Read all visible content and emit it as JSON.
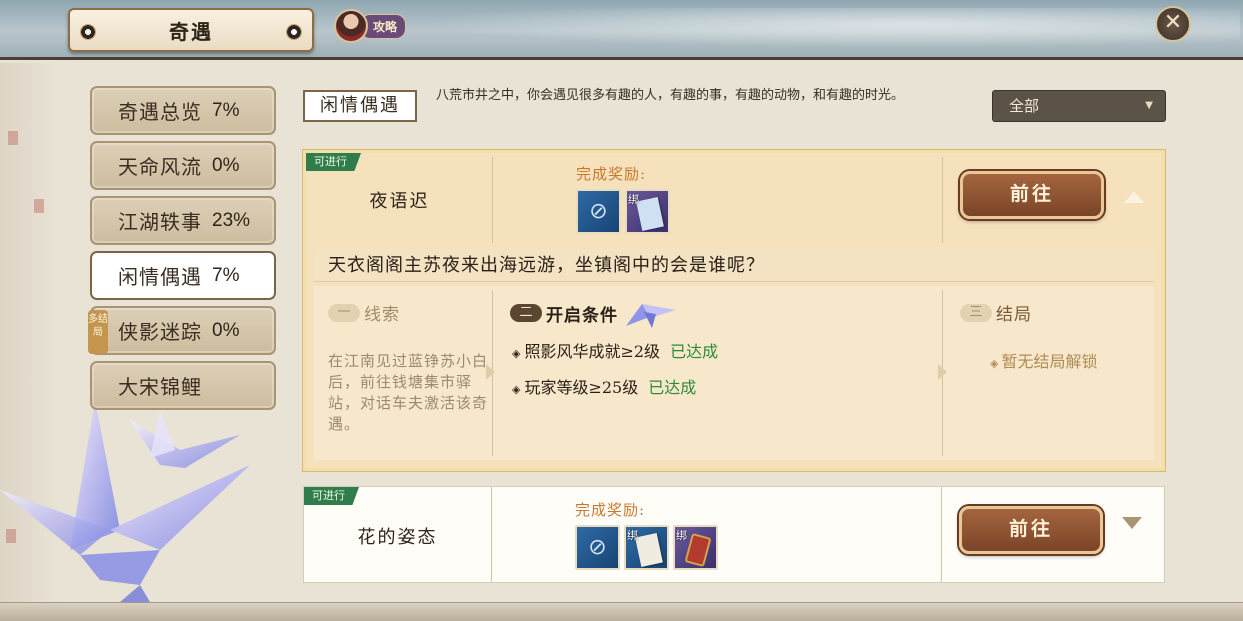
{
  "header": {
    "title": "奇遇",
    "guide_label": "攻略",
    "close_label": "✕"
  },
  "nav": {
    "items": [
      {
        "name": "奇遇总览",
        "pct": "7%"
      },
      {
        "name": "天命风流",
        "pct": "0%"
      },
      {
        "name": "江湖轶事",
        "pct": "23%"
      },
      {
        "name": "闲情偶遇",
        "pct": "7%"
      },
      {
        "name": "侠影迷踪",
        "pct": "0%",
        "badge": "多结局"
      },
      {
        "name": "大宋锦鲤",
        "pct": ""
      }
    ],
    "active_index": 3
  },
  "category": {
    "label": "闲情偶遇",
    "description": "八荒市井之中，你会遇见很多有趣的人，有趣的事，有趣的动物，和有趣的时光。",
    "filter": "全部"
  },
  "quests": [
    {
      "status": "可进行",
      "name": "夜语迟",
      "reward_title": "完成奖励:",
      "go_label": "前往",
      "story": "天衣阁阁主苏夜来出海远游，坐镇阁中的会是谁呢？",
      "clue_title": "线索",
      "clue_num": "一",
      "clue_text": "在江南见过蓝铮苏小白后，前往钱塘集市驿站，对话车夫激活该奇遇。",
      "condition_title": "开启条件",
      "condition_num": "二",
      "conditions": [
        {
          "text": "照影风华成就≥2级",
          "state": "已达成"
        },
        {
          "text": "玩家等级≥25级",
          "state": "已达成"
        }
      ],
      "ending_title": "结局",
      "ending_num": "三",
      "ending_text": "暂无结局解锁",
      "bind_label": "绑"
    },
    {
      "status": "可进行",
      "name": "花的姿态",
      "reward_title": "完成奖励:",
      "go_label": "前往",
      "bind_label": "绑"
    }
  ],
  "icons": {
    "bullet": "◈",
    "reward_glyph": "⊘"
  }
}
